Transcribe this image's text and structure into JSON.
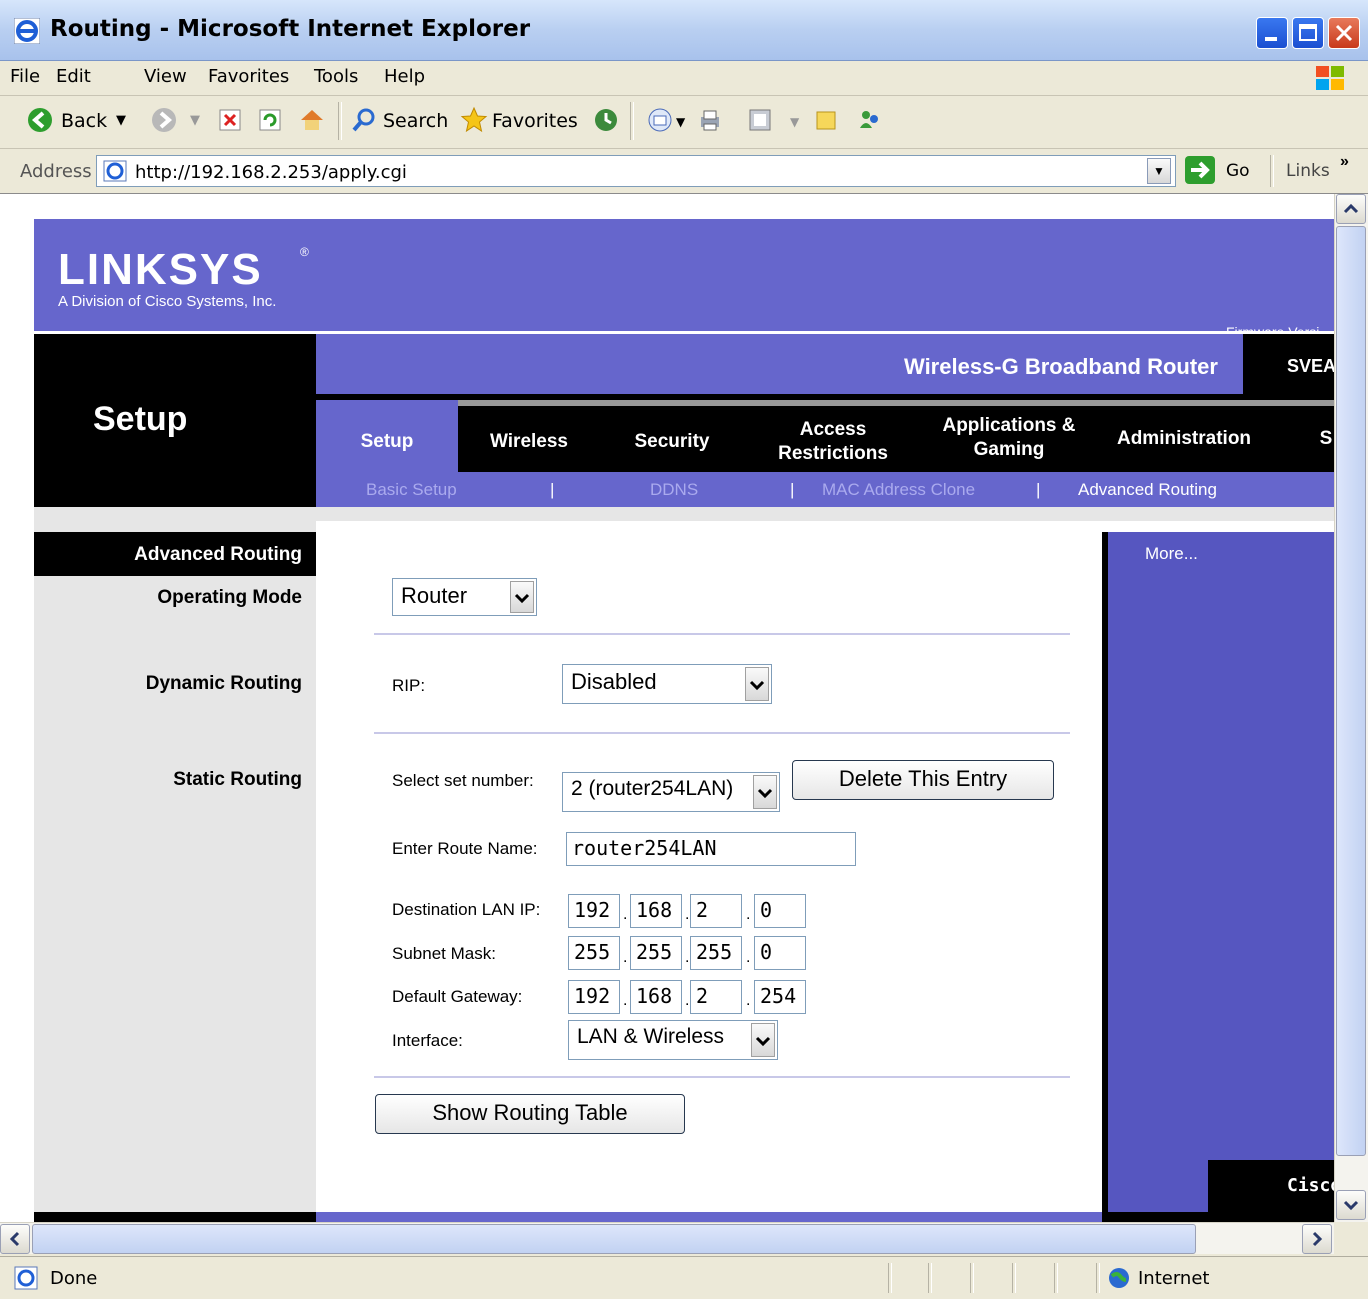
{
  "window": {
    "title": "Routing - Microsoft Internet Explorer"
  },
  "menu": [
    "File",
    "Edit",
    "View",
    "Favorites",
    "Tools",
    "Help"
  ],
  "toolbar": {
    "back": "Back",
    "search": "Search",
    "favorites": "Favorites"
  },
  "address": {
    "label": "Address",
    "url": "http://192.168.2.253/apply.cgi",
    "go": "Go",
    "links": "Links"
  },
  "status": {
    "text": "Done",
    "zone": "Internet"
  },
  "page": {
    "brand": "LINKSYS",
    "brand_mark": "®",
    "brand_sub": "A Division of Cisco Systems, Inc.",
    "firmware": "Firmware Versi",
    "product": "Wireless-G Broadband Router",
    "model": "SVEA",
    "section": "Setup",
    "tabs": [
      "Setup",
      "Wireless",
      "Security",
      "Access Restrictions",
      "Applications & Gaming",
      "Administration",
      "S"
    ],
    "subnav": [
      "Basic Setup",
      "DDNS",
      "MAC Address Clone",
      "Advanced Routing"
    ],
    "subnav_sep": "|",
    "side": {
      "title": "Advanced Routing",
      "operating_mode": "Operating Mode",
      "dynamic_routing": "Dynamic Routing",
      "static_routing": "Static Routing"
    },
    "form": {
      "operating_mode_value": "Router",
      "rip_label": "RIP:",
      "rip_value": "Disabled",
      "set_label": "Select set number:",
      "set_value": "2 (router254LAN)",
      "delete_button": "Delete This Entry",
      "route_name_label": "Enter Route Name:",
      "route_name_value": "router254LAN",
      "dest_label": "Destination LAN IP:",
      "dest_ip": [
        "192",
        "168",
        "2",
        "0"
      ],
      "mask_label": "Subnet Mask:",
      "mask_ip": [
        "255",
        "255",
        "255",
        "0"
      ],
      "gw_label": "Default Gateway:",
      "gw_ip": [
        "192",
        "168",
        "2",
        "254"
      ],
      "iface_label": "Interface:",
      "iface_value": "LAN & Wireless",
      "show_table_button": "Show Routing Table",
      "ip_dot": "."
    },
    "right": {
      "more": "More...",
      "footer_brand": "Cisco"
    }
  },
  "colors": {
    "linksys_blue": "#6666cc",
    "panel_blue": "#5656c0",
    "xp_chrome": "#ece9d8"
  }
}
